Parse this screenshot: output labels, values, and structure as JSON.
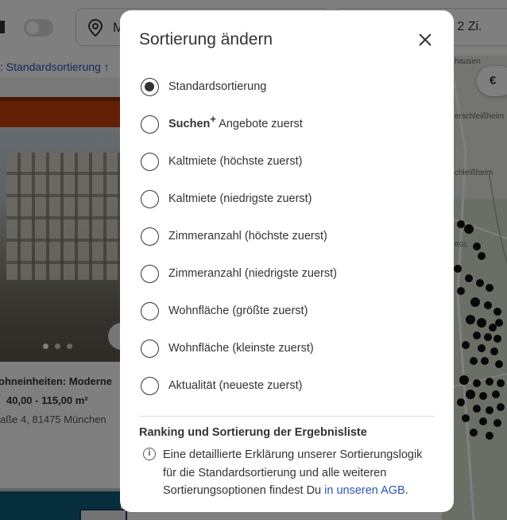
{
  "background": {
    "location_text": "M",
    "rooms_text": "b 2 Zi.",
    "sort_prefix": ":",
    "sort_value": "Standardsortierung",
    "card": {
      "title": "ohneinheiten: Moderne",
      "area": "40,00 - 115,00 m²",
      "address": "aße 4, 81475 München"
    },
    "map": {
      "button_label": "€",
      "labels": [
        "hausen",
        "erschleißheim",
        "chleißheim",
        "RGL"
      ]
    }
  },
  "modal": {
    "title": "Sortierung ändern",
    "options": [
      {
        "label": "Standardsortierung",
        "checked": true
      },
      {
        "label_bold": "Suchen",
        "label_sup": "+",
        "label_rest": " Angebote zuerst",
        "checked": false
      },
      {
        "label": "Kaltmiete (höchste zuerst)",
        "checked": false
      },
      {
        "label": "Kaltmiete (niedrigste zuerst)",
        "checked": false
      },
      {
        "label": "Zimmeranzahl (höchste zuerst)",
        "checked": false
      },
      {
        "label": "Zimmeranzahl (niedrigste zuerst)",
        "checked": false
      },
      {
        "label": "Wohnfläche (größte zuerst)",
        "checked": false
      },
      {
        "label": "Wohnfläche (kleinste zuerst)",
        "checked": false
      },
      {
        "label": "Aktualität (neueste zuerst)",
        "checked": false
      }
    ],
    "info": {
      "title": "Ranking und Sortierung der Ergebnisliste",
      "icon": "info-icon",
      "text": "Eine detaillierte Erklärung unserer Sortierungslogik für die Standardsortierung und alle weiteren Sortierungsoptionen findest Du ",
      "link": "in unseren AGB",
      "after_link": "."
    }
  }
}
